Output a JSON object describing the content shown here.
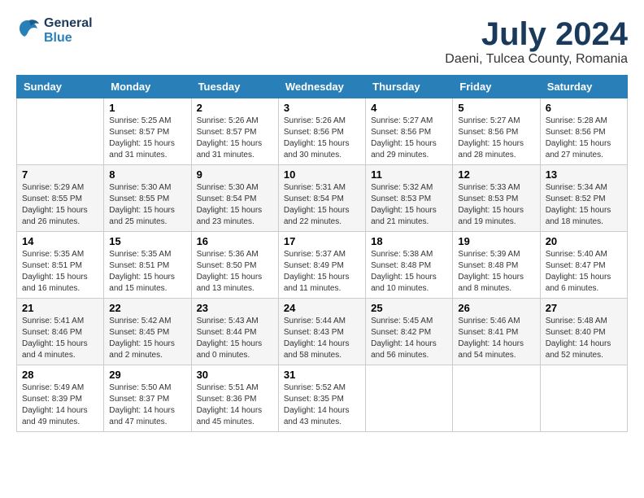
{
  "logo": {
    "text_general": "General",
    "text_blue": "Blue"
  },
  "title": {
    "month_year": "July 2024",
    "location": "Daeni, Tulcea County, Romania"
  },
  "days_of_week": [
    "Sunday",
    "Monday",
    "Tuesday",
    "Wednesday",
    "Thursday",
    "Friday",
    "Saturday"
  ],
  "weeks": [
    [
      {
        "day": "",
        "sunrise": "",
        "sunset": "",
        "daylight": ""
      },
      {
        "day": "1",
        "sunrise": "Sunrise: 5:25 AM",
        "sunset": "Sunset: 8:57 PM",
        "daylight": "Daylight: 15 hours and 31 minutes."
      },
      {
        "day": "2",
        "sunrise": "Sunrise: 5:26 AM",
        "sunset": "Sunset: 8:57 PM",
        "daylight": "Daylight: 15 hours and 31 minutes."
      },
      {
        "day": "3",
        "sunrise": "Sunrise: 5:26 AM",
        "sunset": "Sunset: 8:56 PM",
        "daylight": "Daylight: 15 hours and 30 minutes."
      },
      {
        "day": "4",
        "sunrise": "Sunrise: 5:27 AM",
        "sunset": "Sunset: 8:56 PM",
        "daylight": "Daylight: 15 hours and 29 minutes."
      },
      {
        "day": "5",
        "sunrise": "Sunrise: 5:27 AM",
        "sunset": "Sunset: 8:56 PM",
        "daylight": "Daylight: 15 hours and 28 minutes."
      },
      {
        "day": "6",
        "sunrise": "Sunrise: 5:28 AM",
        "sunset": "Sunset: 8:56 PM",
        "daylight": "Daylight: 15 hours and 27 minutes."
      }
    ],
    [
      {
        "day": "7",
        "sunrise": "Sunrise: 5:29 AM",
        "sunset": "Sunset: 8:55 PM",
        "daylight": "Daylight: 15 hours and 26 minutes."
      },
      {
        "day": "8",
        "sunrise": "Sunrise: 5:30 AM",
        "sunset": "Sunset: 8:55 PM",
        "daylight": "Daylight: 15 hours and 25 minutes."
      },
      {
        "day": "9",
        "sunrise": "Sunrise: 5:30 AM",
        "sunset": "Sunset: 8:54 PM",
        "daylight": "Daylight: 15 hours and 23 minutes."
      },
      {
        "day": "10",
        "sunrise": "Sunrise: 5:31 AM",
        "sunset": "Sunset: 8:54 PM",
        "daylight": "Daylight: 15 hours and 22 minutes."
      },
      {
        "day": "11",
        "sunrise": "Sunrise: 5:32 AM",
        "sunset": "Sunset: 8:53 PM",
        "daylight": "Daylight: 15 hours and 21 minutes."
      },
      {
        "day": "12",
        "sunrise": "Sunrise: 5:33 AM",
        "sunset": "Sunset: 8:53 PM",
        "daylight": "Daylight: 15 hours and 19 minutes."
      },
      {
        "day": "13",
        "sunrise": "Sunrise: 5:34 AM",
        "sunset": "Sunset: 8:52 PM",
        "daylight": "Daylight: 15 hours and 18 minutes."
      }
    ],
    [
      {
        "day": "14",
        "sunrise": "Sunrise: 5:35 AM",
        "sunset": "Sunset: 8:51 PM",
        "daylight": "Daylight: 15 hours and 16 minutes."
      },
      {
        "day": "15",
        "sunrise": "Sunrise: 5:35 AM",
        "sunset": "Sunset: 8:51 PM",
        "daylight": "Daylight: 15 hours and 15 minutes."
      },
      {
        "day": "16",
        "sunrise": "Sunrise: 5:36 AM",
        "sunset": "Sunset: 8:50 PM",
        "daylight": "Daylight: 15 hours and 13 minutes."
      },
      {
        "day": "17",
        "sunrise": "Sunrise: 5:37 AM",
        "sunset": "Sunset: 8:49 PM",
        "daylight": "Daylight: 15 hours and 11 minutes."
      },
      {
        "day": "18",
        "sunrise": "Sunrise: 5:38 AM",
        "sunset": "Sunset: 8:48 PM",
        "daylight": "Daylight: 15 hours and 10 minutes."
      },
      {
        "day": "19",
        "sunrise": "Sunrise: 5:39 AM",
        "sunset": "Sunset: 8:48 PM",
        "daylight": "Daylight: 15 hours and 8 minutes."
      },
      {
        "day": "20",
        "sunrise": "Sunrise: 5:40 AM",
        "sunset": "Sunset: 8:47 PM",
        "daylight": "Daylight: 15 hours and 6 minutes."
      }
    ],
    [
      {
        "day": "21",
        "sunrise": "Sunrise: 5:41 AM",
        "sunset": "Sunset: 8:46 PM",
        "daylight": "Daylight: 15 hours and 4 minutes."
      },
      {
        "day": "22",
        "sunrise": "Sunrise: 5:42 AM",
        "sunset": "Sunset: 8:45 PM",
        "daylight": "Daylight: 15 hours and 2 minutes."
      },
      {
        "day": "23",
        "sunrise": "Sunrise: 5:43 AM",
        "sunset": "Sunset: 8:44 PM",
        "daylight": "Daylight: 15 hours and 0 minutes."
      },
      {
        "day": "24",
        "sunrise": "Sunrise: 5:44 AM",
        "sunset": "Sunset: 8:43 PM",
        "daylight": "Daylight: 14 hours and 58 minutes."
      },
      {
        "day": "25",
        "sunrise": "Sunrise: 5:45 AM",
        "sunset": "Sunset: 8:42 PM",
        "daylight": "Daylight: 14 hours and 56 minutes."
      },
      {
        "day": "26",
        "sunrise": "Sunrise: 5:46 AM",
        "sunset": "Sunset: 8:41 PM",
        "daylight": "Daylight: 14 hours and 54 minutes."
      },
      {
        "day": "27",
        "sunrise": "Sunrise: 5:48 AM",
        "sunset": "Sunset: 8:40 PM",
        "daylight": "Daylight: 14 hours and 52 minutes."
      }
    ],
    [
      {
        "day": "28",
        "sunrise": "Sunrise: 5:49 AM",
        "sunset": "Sunset: 8:39 PM",
        "daylight": "Daylight: 14 hours and 49 minutes."
      },
      {
        "day": "29",
        "sunrise": "Sunrise: 5:50 AM",
        "sunset": "Sunset: 8:37 PM",
        "daylight": "Daylight: 14 hours and 47 minutes."
      },
      {
        "day": "30",
        "sunrise": "Sunrise: 5:51 AM",
        "sunset": "Sunset: 8:36 PM",
        "daylight": "Daylight: 14 hours and 45 minutes."
      },
      {
        "day": "31",
        "sunrise": "Sunrise: 5:52 AM",
        "sunset": "Sunset: 8:35 PM",
        "daylight": "Daylight: 14 hours and 43 minutes."
      },
      {
        "day": "",
        "sunrise": "",
        "sunset": "",
        "daylight": ""
      },
      {
        "day": "",
        "sunrise": "",
        "sunset": "",
        "daylight": ""
      },
      {
        "day": "",
        "sunrise": "",
        "sunset": "",
        "daylight": ""
      }
    ]
  ]
}
